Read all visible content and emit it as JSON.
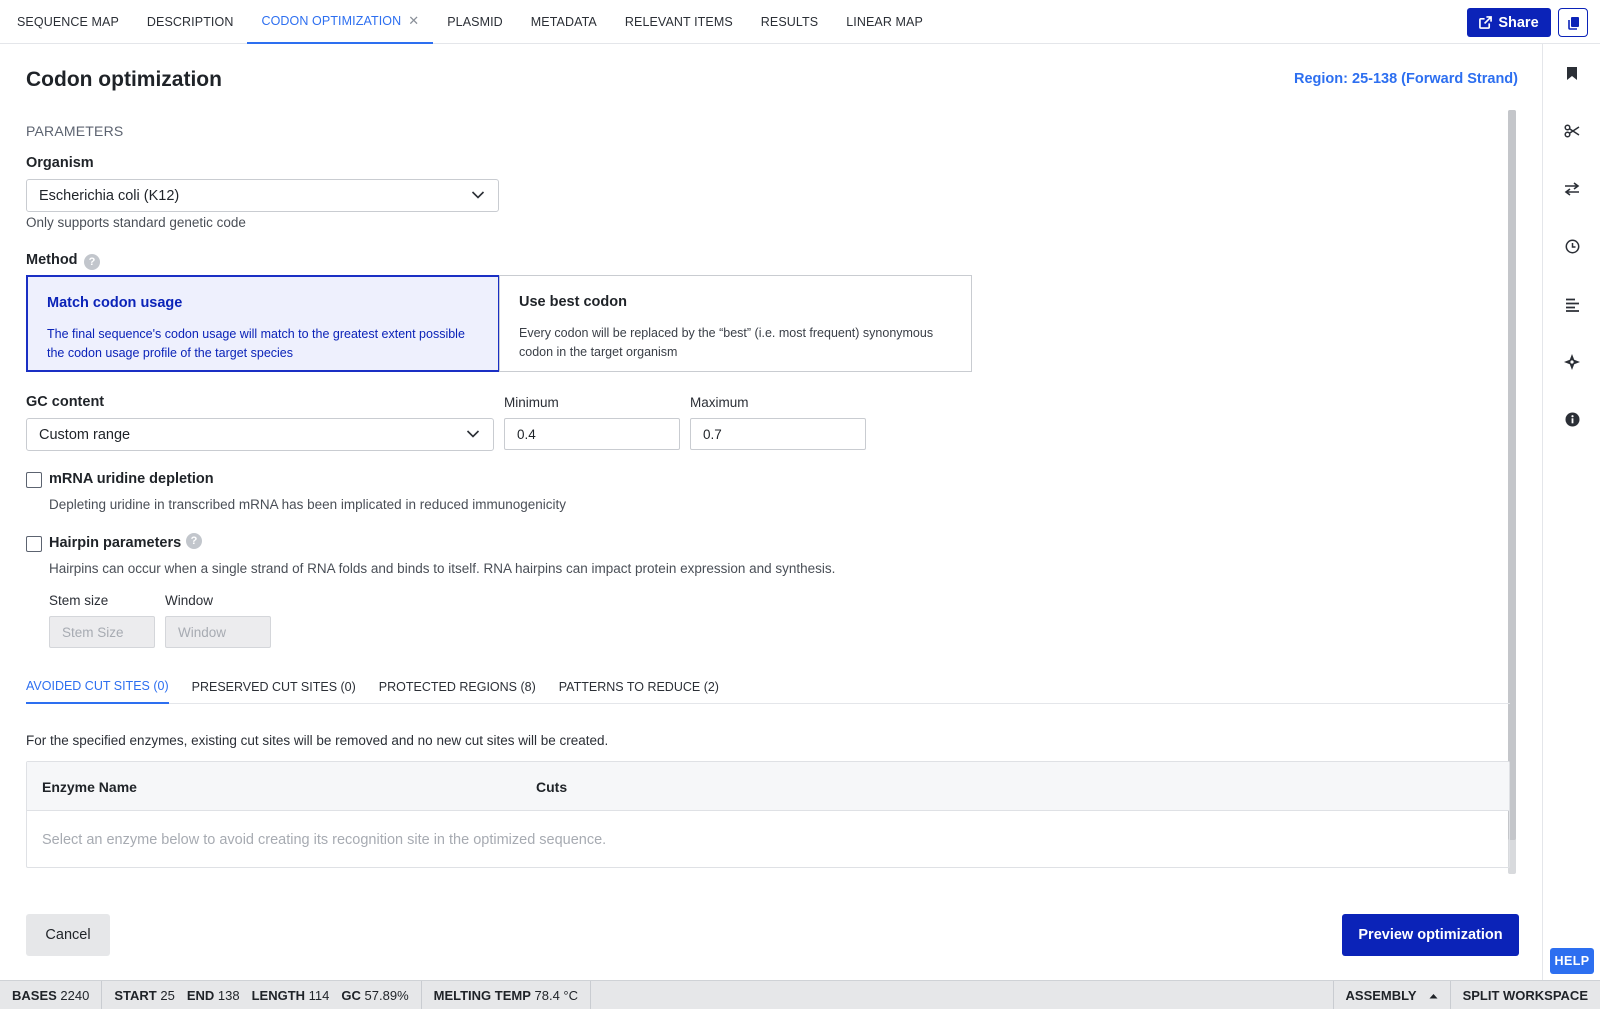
{
  "tabs": [
    {
      "label": "SEQUENCE MAP"
    },
    {
      "label": "DESCRIPTION"
    },
    {
      "label": "CODON OPTIMIZATION"
    },
    {
      "label": "PLASMID"
    },
    {
      "label": "METADATA"
    },
    {
      "label": "RELEVANT ITEMS"
    },
    {
      "label": "RESULTS"
    },
    {
      "label": "LINEAR MAP"
    }
  ],
  "active_tab": "CODON OPTIMIZATION",
  "header": {
    "share_label": "Share"
  },
  "panel": {
    "title": "Codon optimization",
    "region": "Region: 25-138 (Forward Strand)"
  },
  "params": {
    "section_label": "PARAMETERS",
    "organism_label": "Organism",
    "organism_value": "Escherichia coli (K12)",
    "organism_hint": "Only supports standard genetic code",
    "method_label": "Method",
    "methods": [
      {
        "title": "Match codon usage",
        "desc": "The final sequence's codon usage will match to the greatest extent possible the codon usage profile of the target species",
        "selected": true
      },
      {
        "title": "Use best codon",
        "desc": "Every codon will be replaced by the “best” (i.e. most frequent) synonymous codon in the target organism",
        "selected": false
      }
    ],
    "gc_label": "GC content",
    "gc_value": "Custom range",
    "min_label": "Minimum",
    "min_value": "0.4",
    "max_label": "Maximum",
    "max_value": "0.7",
    "uridine_label": "mRNA uridine depletion",
    "uridine_hint": "Depleting uridine in transcribed mRNA has been implicated in reduced immunogenicity",
    "hairpin_label": "Hairpin parameters",
    "hairpin_hint": "Hairpins can occur when a single strand of RNA folds and binds to itself. RNA hairpins can impact protein expression and synthesis.",
    "stem_label": "Stem size",
    "stem_placeholder": "Stem Size",
    "window_label": "Window",
    "window_placeholder": "Window"
  },
  "subtabs": [
    {
      "label": "AVOIDED CUT SITES (0)"
    },
    {
      "label": "PRESERVED CUT SITES (0)"
    },
    {
      "label": "PROTECTED REGIONS (8)"
    },
    {
      "label": "PATTERNS TO REDUCE (2)"
    }
  ],
  "cut_sites": {
    "description": "For the specified enzymes, existing cut sites will be removed and no new cut sites will be created.",
    "col_enzyme": "Enzyme Name",
    "col_cuts": "Cuts",
    "empty": "Select an enzyme below to avoid creating its recognition site in the optimized sequence."
  },
  "footer": {
    "cancel": "Cancel",
    "preview": "Preview optimization",
    "help": "HELP"
  },
  "status": {
    "bases_k": "BASES",
    "bases_v": "2240",
    "start_k": "START",
    "start_v": "25",
    "end_k": "END",
    "end_v": "138",
    "length_k": "LENGTH",
    "length_v": "114",
    "gc_k": "GC",
    "gc_v": "57.89%",
    "melt_k": "MELTING TEMP",
    "melt_v": "78.4 °C",
    "assembly": "ASSEMBLY",
    "split": "SPLIT WORKSPACE"
  },
  "colors": {
    "accent": "#2d6ff0",
    "primary": "#0b23b8"
  }
}
